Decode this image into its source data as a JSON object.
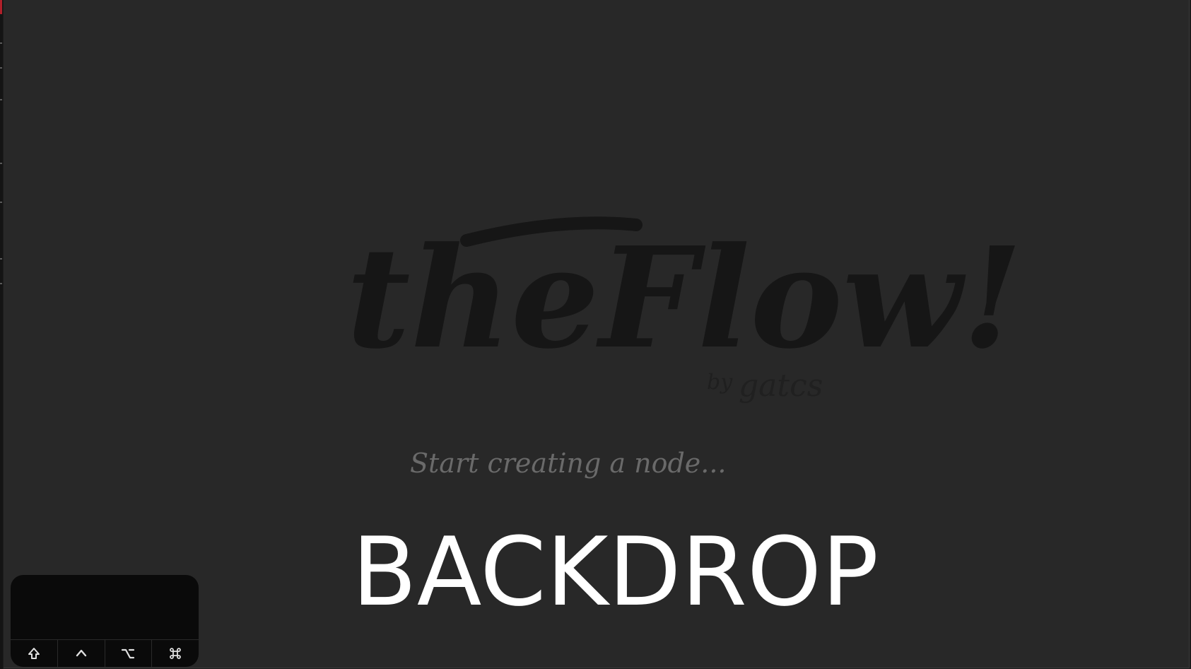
{
  "logo": {
    "title": "theFlow!",
    "byline_prefix": "by",
    "byline_author": "gatcs",
    "tagline": "Start creating a node..."
  },
  "canvas": {
    "label": "BACKDROP"
  },
  "modifier_keys": [
    {
      "name": "shift",
      "icon": "shift-icon",
      "glyph": "⇧"
    },
    {
      "name": "control",
      "icon": "control-icon",
      "glyph": "^"
    },
    {
      "name": "option",
      "icon": "option-icon",
      "glyph": "⌥"
    },
    {
      "name": "command",
      "icon": "command-icon",
      "glyph": "⌘"
    }
  ],
  "colors": {
    "background": "#282828",
    "logo": "#161616",
    "tagline": "#6a6a6a",
    "label": "#ffffff",
    "panel": "#0a0a0a",
    "accent_red": "#b0202a"
  }
}
